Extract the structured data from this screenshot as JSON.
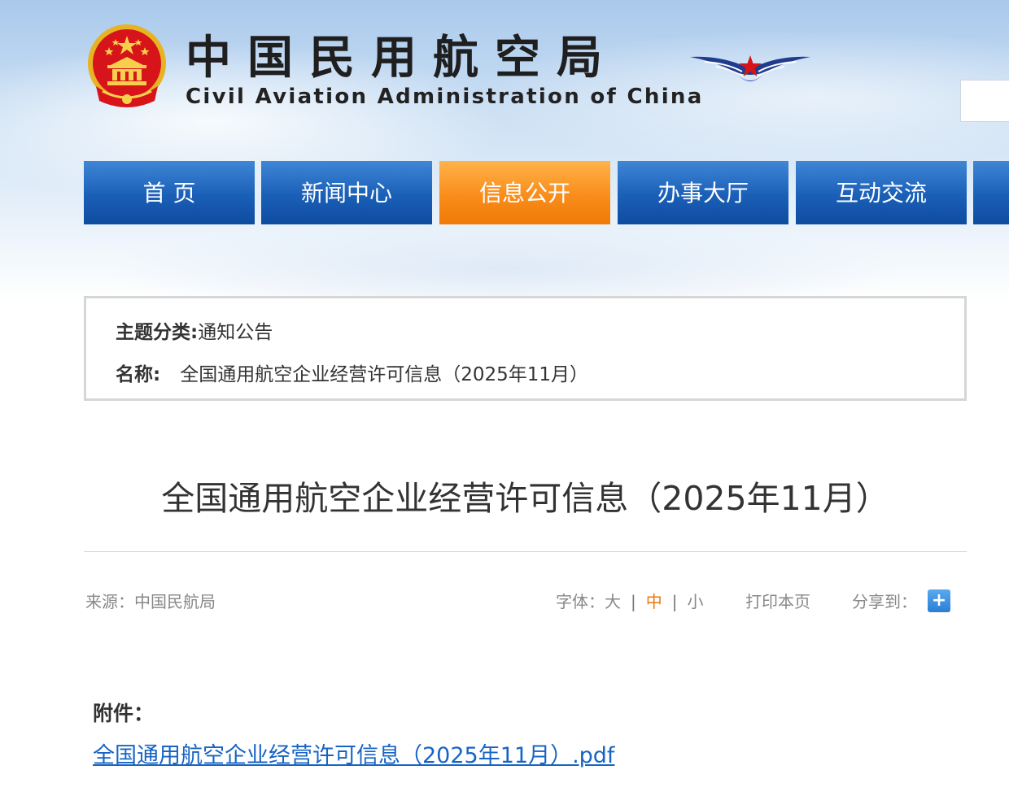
{
  "header": {
    "org_name_cn": "中国民用航空局",
    "org_name_en": "Civil Aviation Administration of China",
    "emblem": "national-emblem-icon",
    "logo": "caac-wings-logo"
  },
  "nav": {
    "items": [
      {
        "label": "首 页",
        "active": false
      },
      {
        "label": "新闻中心",
        "active": false
      },
      {
        "label": "信息公开",
        "active": true
      },
      {
        "label": "办事大厅",
        "active": false
      },
      {
        "label": "互动交流",
        "active": false
      }
    ]
  },
  "info_box": {
    "category_label": "主题分类:",
    "category_value": "通知公告",
    "name_label": "名称:",
    "name_value": "全国通用航空企业经营许可信息（2025年11月）"
  },
  "article": {
    "title": "全国通用航空企业经营许可信息（2025年11月）",
    "source": "来源：中国民航局",
    "font_label": "字体：",
    "font_large": "大",
    "font_medium": "中",
    "font_small": "小",
    "sep": "|",
    "print_label": "打印本页",
    "share_label": "分享到：",
    "share_icon": "+",
    "attachment_label": "附件：",
    "attachment_link": "全国通用航空企业经营许可信息（2025年11月）.pdf"
  },
  "colors": {
    "nav_blue": "#1a5fb7",
    "nav_active_orange": "#f98d1b",
    "link_blue": "#1764c4",
    "font_active": "#e67a12"
  }
}
